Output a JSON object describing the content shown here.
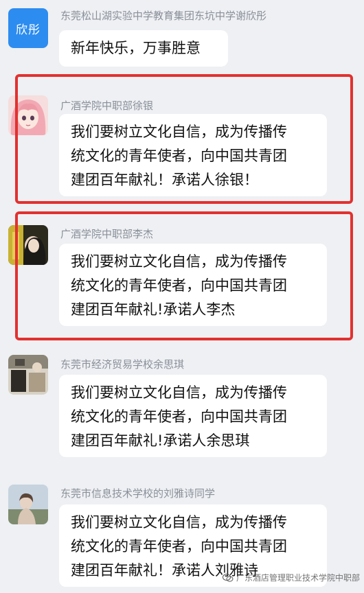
{
  "messages": [
    {
      "sender": "东莞松山湖实验中学教育集团东坑中学谢欣彤",
      "avatar_text": "欣彤",
      "avatar_icon": "text-avatar",
      "lines": [
        "新年快乐，万事胜意"
      ]
    },
    {
      "sender": "广酒学院中职部徐银",
      "avatar_icon": "anime-girl-avatar",
      "lines": [
        "我们要树立文化自信，成为传播传",
        "统文化的青年使者，向中国共青团",
        "建团百年献礼！承诺人徐银！"
      ]
    },
    {
      "sender": "广酒学院中职部李杰",
      "avatar_icon": "photo-avatar",
      "lines": [
        "我们要树立文化自信，成为传播传",
        "统文化的青年使者，向中国共青团",
        "建团百年献礼!承诺人李杰"
      ]
    },
    {
      "sender": "东莞市经济贸易学校余思琪",
      "avatar_icon": "photo-avatar",
      "lines": [
        "我们要树立文化自信，成为传播传",
        "统文化的青年使者，向中国共青团",
        "建团百年献礼!承诺人余思琪"
      ]
    },
    {
      "sender": "东莞市信息技术学校的刘雅诗同学",
      "avatar_icon": "photo-avatar",
      "lines": [
        "我们要树立文化自信，成为传播传",
        "统文化的青年使者，向中国共青团",
        "建团百年献礼！承诺人刘雅诗"
      ]
    }
  ],
  "watermark": {
    "text": "广东酒店管理职业技术学院中职部",
    "icon": "wechat-icon"
  },
  "colors": {
    "background": "#eef0f3",
    "highlight_border": "#e2312f",
    "avatar_blue": "#2d8cf0"
  }
}
